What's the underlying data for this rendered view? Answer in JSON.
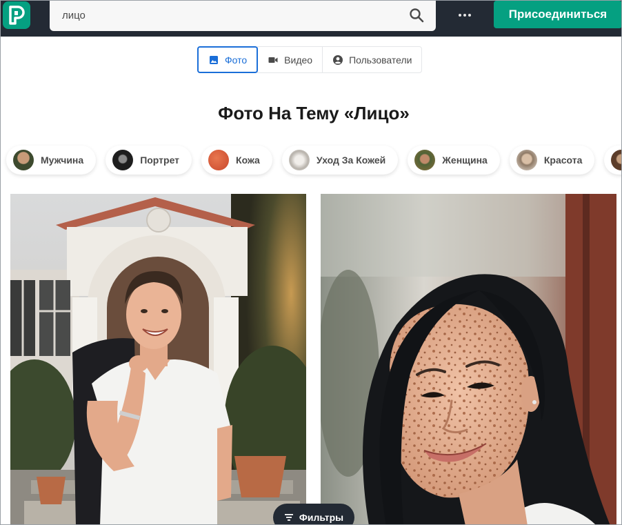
{
  "header": {
    "search_value": "лицо",
    "join_label": "Присоединиться",
    "logo_icon": "pexels-logo-icon",
    "more_icon": "more-dots-icon",
    "brand_color": "#05a081"
  },
  "tabs": [
    {
      "label": "Фото",
      "icon": "image-icon",
      "active": true
    },
    {
      "label": "Видео",
      "icon": "video-camera-icon",
      "active": false
    },
    {
      "label": "Пользователи",
      "icon": "user-circle-icon",
      "active": false
    }
  ],
  "page_title": "Фото На Тему «Лицо»",
  "chips": [
    {
      "label": "Мужчина",
      "color": "#6b5a3e"
    },
    {
      "label": "Портрет",
      "color": "#2c2c2c"
    },
    {
      "label": "Кожа",
      "color": "#d4573b"
    },
    {
      "label": "Уход За Кожей",
      "color": "#c9c6c2"
    },
    {
      "label": "Женщина",
      "color": "#6f7a4a"
    },
    {
      "label": "Красота",
      "color": "#b9a58f"
    }
  ],
  "photos": [
    {
      "alt_subject": "smiling man in white t-shirt in front of house"
    },
    {
      "alt_subject": "smiling freckled woman with dark hair"
    }
  ],
  "filters_label": "Фильтры"
}
